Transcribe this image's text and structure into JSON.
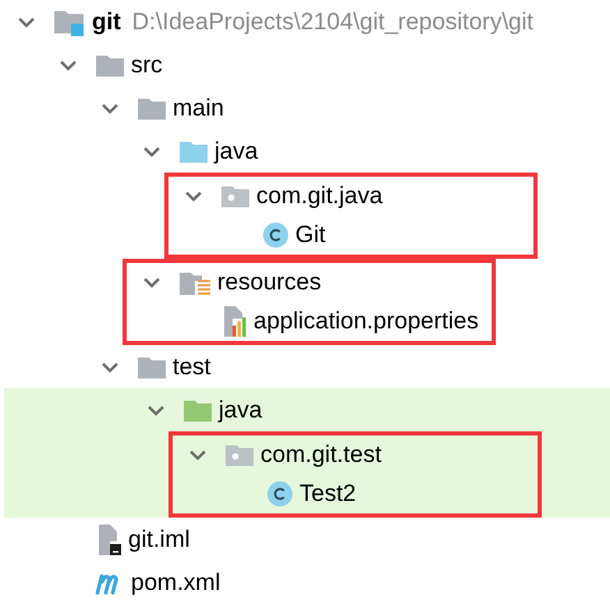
{
  "tree": [
    {
      "label": "git",
      "path": "D:\\IdeaProjects\\2104\\git_repository\\git",
      "kind": "project",
      "expanded": true,
      "highlighted": false,
      "children": [
        {
          "label": "src",
          "kind": "folder",
          "expanded": true,
          "highlighted": false,
          "children": [
            {
              "label": "main",
              "kind": "folder",
              "expanded": true,
              "highlighted": false,
              "children": [
                {
                  "label": "java",
                  "kind": "source-folder",
                  "expanded": true,
                  "highlighted": false,
                  "children": [
                    {
                      "label": "com.git.java",
                      "kind": "package",
                      "expanded": true,
                      "highlighted": true,
                      "children": [
                        {
                          "label": "Git",
                          "kind": "class",
                          "highlighted": false
                        }
                      ]
                    }
                  ]
                },
                {
                  "label": "resources",
                  "kind": "resources-folder",
                  "expanded": true,
                  "highlighted": true,
                  "children": [
                    {
                      "label": "application.properties",
                      "kind": "properties-file",
                      "highlighted": false
                    }
                  ]
                }
              ]
            },
            {
              "label": "test",
              "kind": "folder",
              "expanded": true,
              "highlighted": false,
              "children": [
                {
                  "label": "java",
                  "kind": "test-folder",
                  "expanded": true,
                  "highlighted": false,
                  "children": [
                    {
                      "label": "com.git.test",
                      "kind": "package",
                      "expanded": true,
                      "highlighted": true,
                      "children": [
                        {
                          "label": "Test2",
                          "kind": "class",
                          "highlighted": false
                        }
                      ]
                    }
                  ]
                }
              ]
            }
          ]
        },
        {
          "label": "git.iml",
          "kind": "iml-file",
          "highlighted": false
        },
        {
          "label": "pom.xml",
          "kind": "maven-file",
          "highlighted": false
        }
      ]
    }
  ]
}
